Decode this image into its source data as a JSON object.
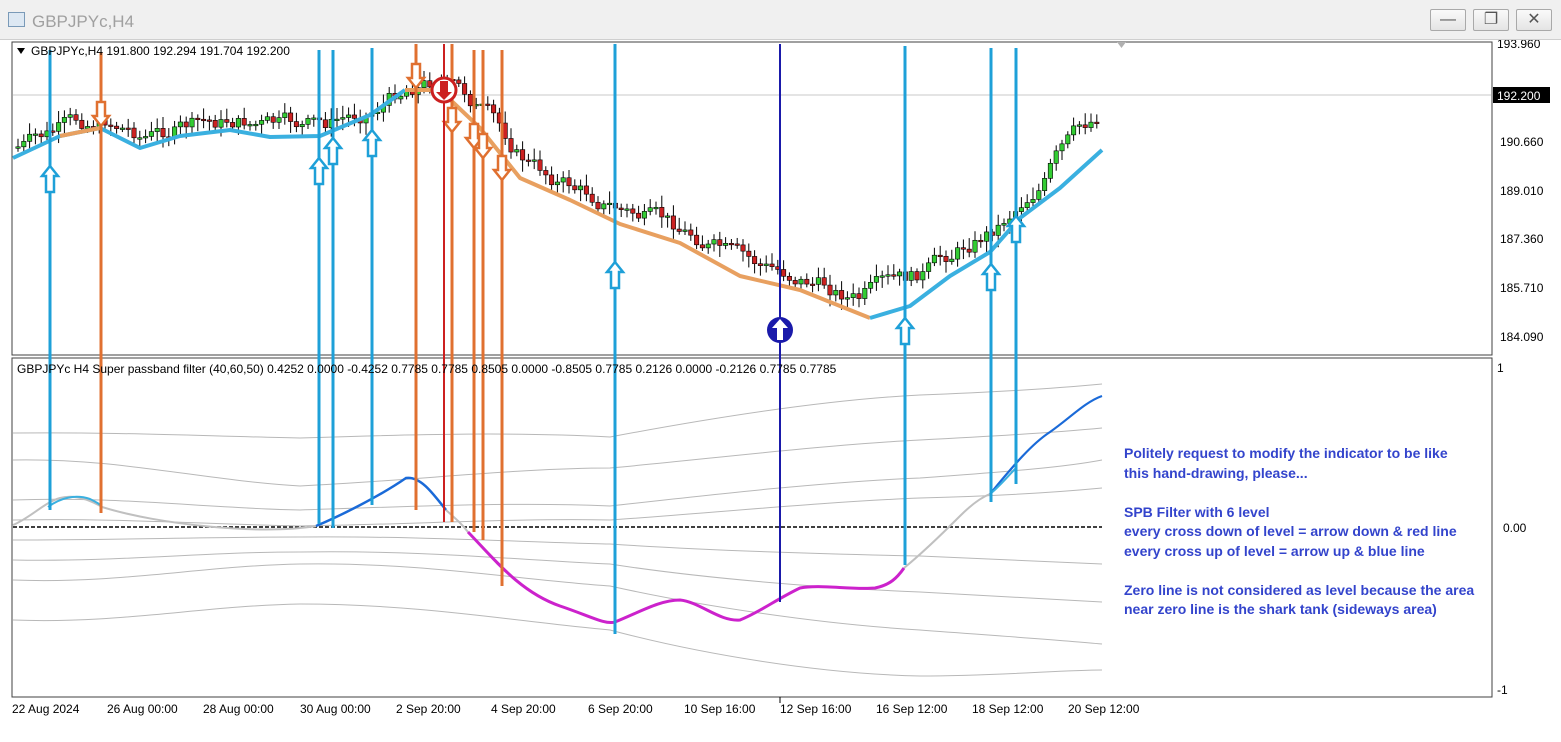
{
  "window": {
    "title": "GBPJPYc,H4",
    "buttons": [
      {
        "name": "minimize",
        "glyph": "—"
      },
      {
        "name": "restore",
        "glyph": "❐"
      },
      {
        "name": "close",
        "glyph": "✕"
      }
    ]
  },
  "main_chart": {
    "info": "GBPJPYc,H4  191.800 192.294 191.704 192.200",
    "current_price": "192.200",
    "price_ticks": [
      "193.960",
      "190.660",
      "189.010",
      "187.360",
      "185.710",
      "184.090"
    ]
  },
  "indicator": {
    "info": "GBPJPYc H4 Super passband filter (40,60,50) 0.4252 0.0000 -0.4252 0.7785 0.7785   0.8505 0.0000 -0.8505 0.7785   0.2126 0.0000 -0.2126 0.7785 0.7785",
    "ticks": [
      "1",
      "0.00",
      "-1"
    ]
  },
  "time_axis": [
    "22 Aug 2024",
    "26 Aug 00:00",
    "28 Aug 00:00",
    "30 Aug 00:00",
    "2 Sep 20:00",
    "4 Sep 20:00",
    "6 Sep 20:00",
    "10 Sep 16:00",
    "12 Sep 16:00",
    "16 Sep 12:00",
    "18 Sep 12:00",
    "20 Sep 12:00"
  ],
  "note_lines": [
    "Politely request to modify the indicator to be like",
    "this hand-drawing, please...",
    "",
    "SPB Filter with 6 level",
    "every cross down of level = arrow down & red line",
    "every cross up of level = arrow up & blue line",
    "",
    "Zero line is not considered as level because the area",
    "near zero line is the shark tank (sideways area)"
  ],
  "colors": {
    "bull": "#33cc33",
    "bear": "#cc2222",
    "ma_up": "#3ab0e0",
    "ma_down": "#e8a060",
    "annot_up": "#1ea0d8",
    "annot_down": "#e07030",
    "annot_red": "#cc2020",
    "annot_navy": "#1a1aaa",
    "filter_down": "#cc22cc",
    "filter_up": "#1a6ad8",
    "note": "#3344cc"
  }
}
